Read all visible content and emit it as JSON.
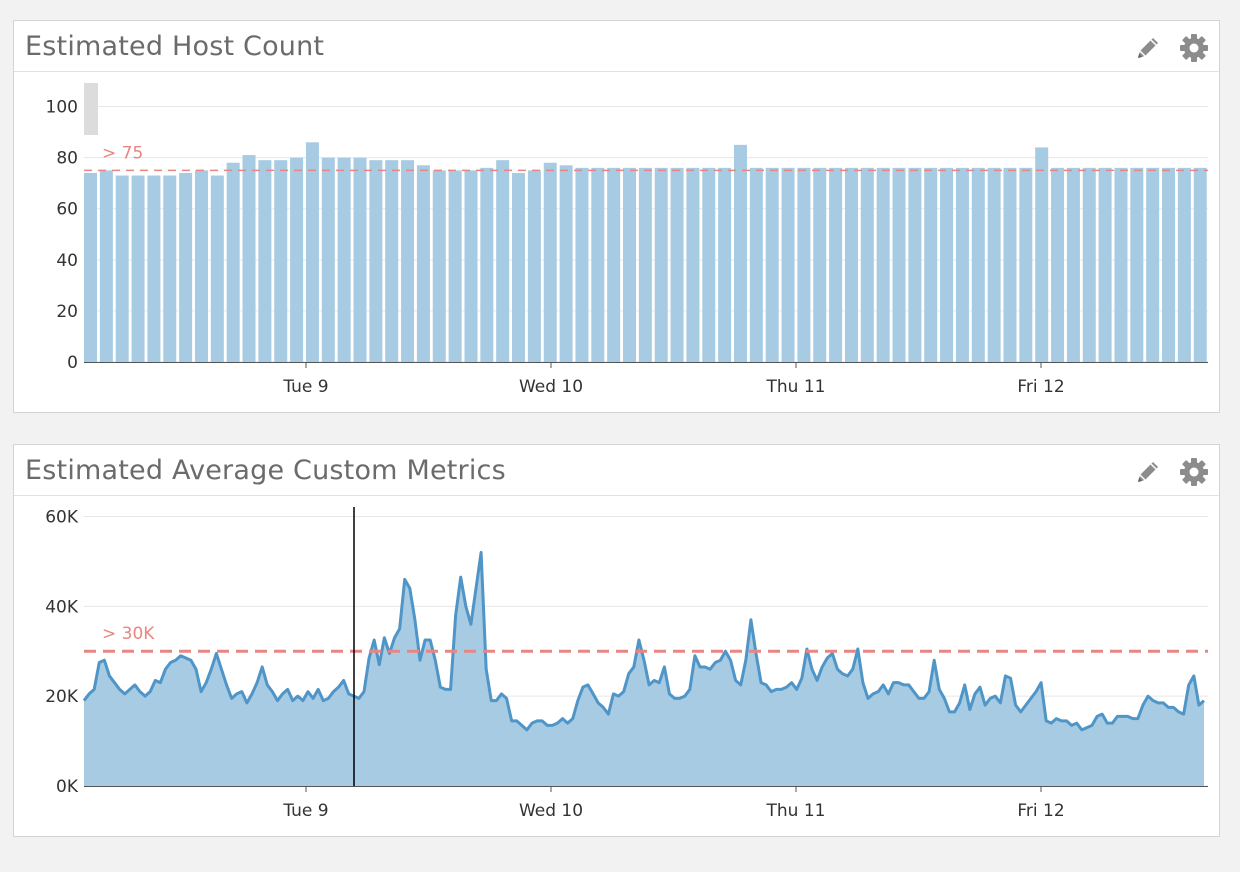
{
  "colors": {
    "bar_fill": "#a6cbe3",
    "area_fill": "#a6cbe3",
    "line_stroke": "#4f95c7",
    "threshold": "#e98582",
    "grid": "#e7e7e7",
    "axis_text": "#333333",
    "title": "#6b6b6b",
    "icon": "#8c8c8c"
  },
  "widgets": [
    {
      "title": "Estimated Host Count",
      "edit_icon": "pencil-icon",
      "settings_icon": "gear-icon",
      "threshold_label": "> 75"
    },
    {
      "title": "Estimated Average Custom Metrics",
      "edit_icon": "pencil-icon",
      "settings_icon": "gear-icon",
      "threshold_label": "> 30K"
    }
  ],
  "chart_data": [
    {
      "type": "bar",
      "title": "Estimated Host Count",
      "xlabel": "",
      "ylabel": "",
      "ylim": [
        0,
        110
      ],
      "y_ticks": [
        0,
        20,
        40,
        60,
        80,
        100
      ],
      "y_tick_labels": [
        "0",
        "20",
        "40",
        "60",
        "80",
        "100"
      ],
      "x_ticks": [
        "Tue 9",
        "Wed 10",
        "Thu 11",
        "Fri 12"
      ],
      "threshold": {
        "value": 75,
        "label": "> 75"
      },
      "grid": true,
      "values": [
        74,
        75,
        73,
        73,
        73,
        73,
        74,
        75,
        73,
        78,
        81,
        79,
        79,
        80,
        86,
        80,
        80,
        80,
        79,
        79,
        79,
        77,
        75,
        75,
        75,
        76,
        79,
        74,
        75,
        78,
        77,
        76,
        76,
        76,
        76,
        76,
        76,
        76,
        76,
        76,
        76,
        85,
        76,
        76,
        76,
        76,
        76,
        76,
        76,
        76,
        76,
        76,
        76,
        76,
        76,
        76,
        76,
        76,
        76,
        76,
        84,
        76,
        76,
        76,
        76,
        76,
        76,
        76,
        76,
        76,
        76
      ]
    },
    {
      "type": "area",
      "title": "Estimated Average Custom Metrics",
      "xlabel": "",
      "ylabel": "",
      "ylim": [
        0,
        63000
      ],
      "y_ticks": [
        0,
        20000,
        40000,
        60000
      ],
      "y_tick_labels": [
        "0K",
        "20K",
        "40K",
        "60K"
      ],
      "x_ticks": [
        "Tue 9",
        "Wed 10",
        "Thu 11",
        "Fri 12"
      ],
      "threshold": {
        "value": 30000,
        "label": "> 30K"
      },
      "grid": true,
      "values": [
        19000,
        20500,
        21500,
        27500,
        28000,
        24500,
        23000,
        21500,
        20500,
        21500,
        22500,
        21000,
        20000,
        21000,
        23500,
        23000,
        26000,
        27500,
        28000,
        29000,
        28500,
        28000,
        26000,
        21000,
        23000,
        26000,
        29500,
        26000,
        22500,
        19500,
        20500,
        21000,
        18500,
        20500,
        23000,
        26500,
        22500,
        21000,
        19000,
        20500,
        21500,
        19000,
        20000,
        19000,
        21000,
        19500,
        21500,
        19000,
        19500,
        21000,
        22000,
        23500,
        20500,
        20000,
        19500,
        21000,
        28500,
        32500,
        27000,
        33000,
        29500,
        33000,
        35000,
        46000,
        44000,
        37000,
        28000,
        32500,
        32500,
        28000,
        22000,
        21500,
        21500,
        38000,
        46500,
        40000,
        36000,
        44000,
        52000,
        26000,
        19000,
        19000,
        20500,
        19500,
        14500,
        14500,
        13500,
        12500,
        14000,
        14500,
        14500,
        13500,
        13500,
        14000,
        15000,
        14000,
        15000,
        19000,
        22000,
        22500,
        20500,
        18500,
        17500,
        16000,
        20500,
        20000,
        21000,
        25000,
        26500,
        32500,
        28000,
        22500,
        23500,
        23000,
        26500,
        20500,
        19500,
        19500,
        20000,
        21500,
        29000,
        26500,
        26500,
        26000,
        27500,
        28000,
        30000,
        28000,
        23500,
        22500,
        28000,
        37000,
        29500,
        23000,
        22500,
        21000,
        21500,
        21500,
        22000,
        23000,
        21500,
        24000,
        30500,
        26000,
        23500,
        26500,
        28500,
        29500,
        26000,
        25000,
        24500,
        26000,
        30500,
        23000,
        19500,
        20500,
        21000,
        22500,
        20500,
        23000,
        23000,
        22500,
        22500,
        21000,
        19500,
        19500,
        21000,
        28000,
        21500,
        19500,
        16500,
        16500,
        18500,
        22500,
        17000,
        20500,
        22000,
        18000,
        19500,
        20000,
        18500,
        24500,
        24000,
        18000,
        16500,
        18000,
        19500,
        21000,
        23000,
        14500,
        14000,
        15000,
        14500,
        14500,
        13500,
        14000,
        12500,
        13000,
        13500,
        15500,
        16000,
        14000,
        14000,
        15500,
        15500,
        15500,
        15000,
        15000,
        18000,
        20000,
        19000,
        18500,
        18500,
        17500,
        17500,
        16500,
        16000,
        22500,
        24500,
        18000,
        19000
      ]
    }
  ]
}
